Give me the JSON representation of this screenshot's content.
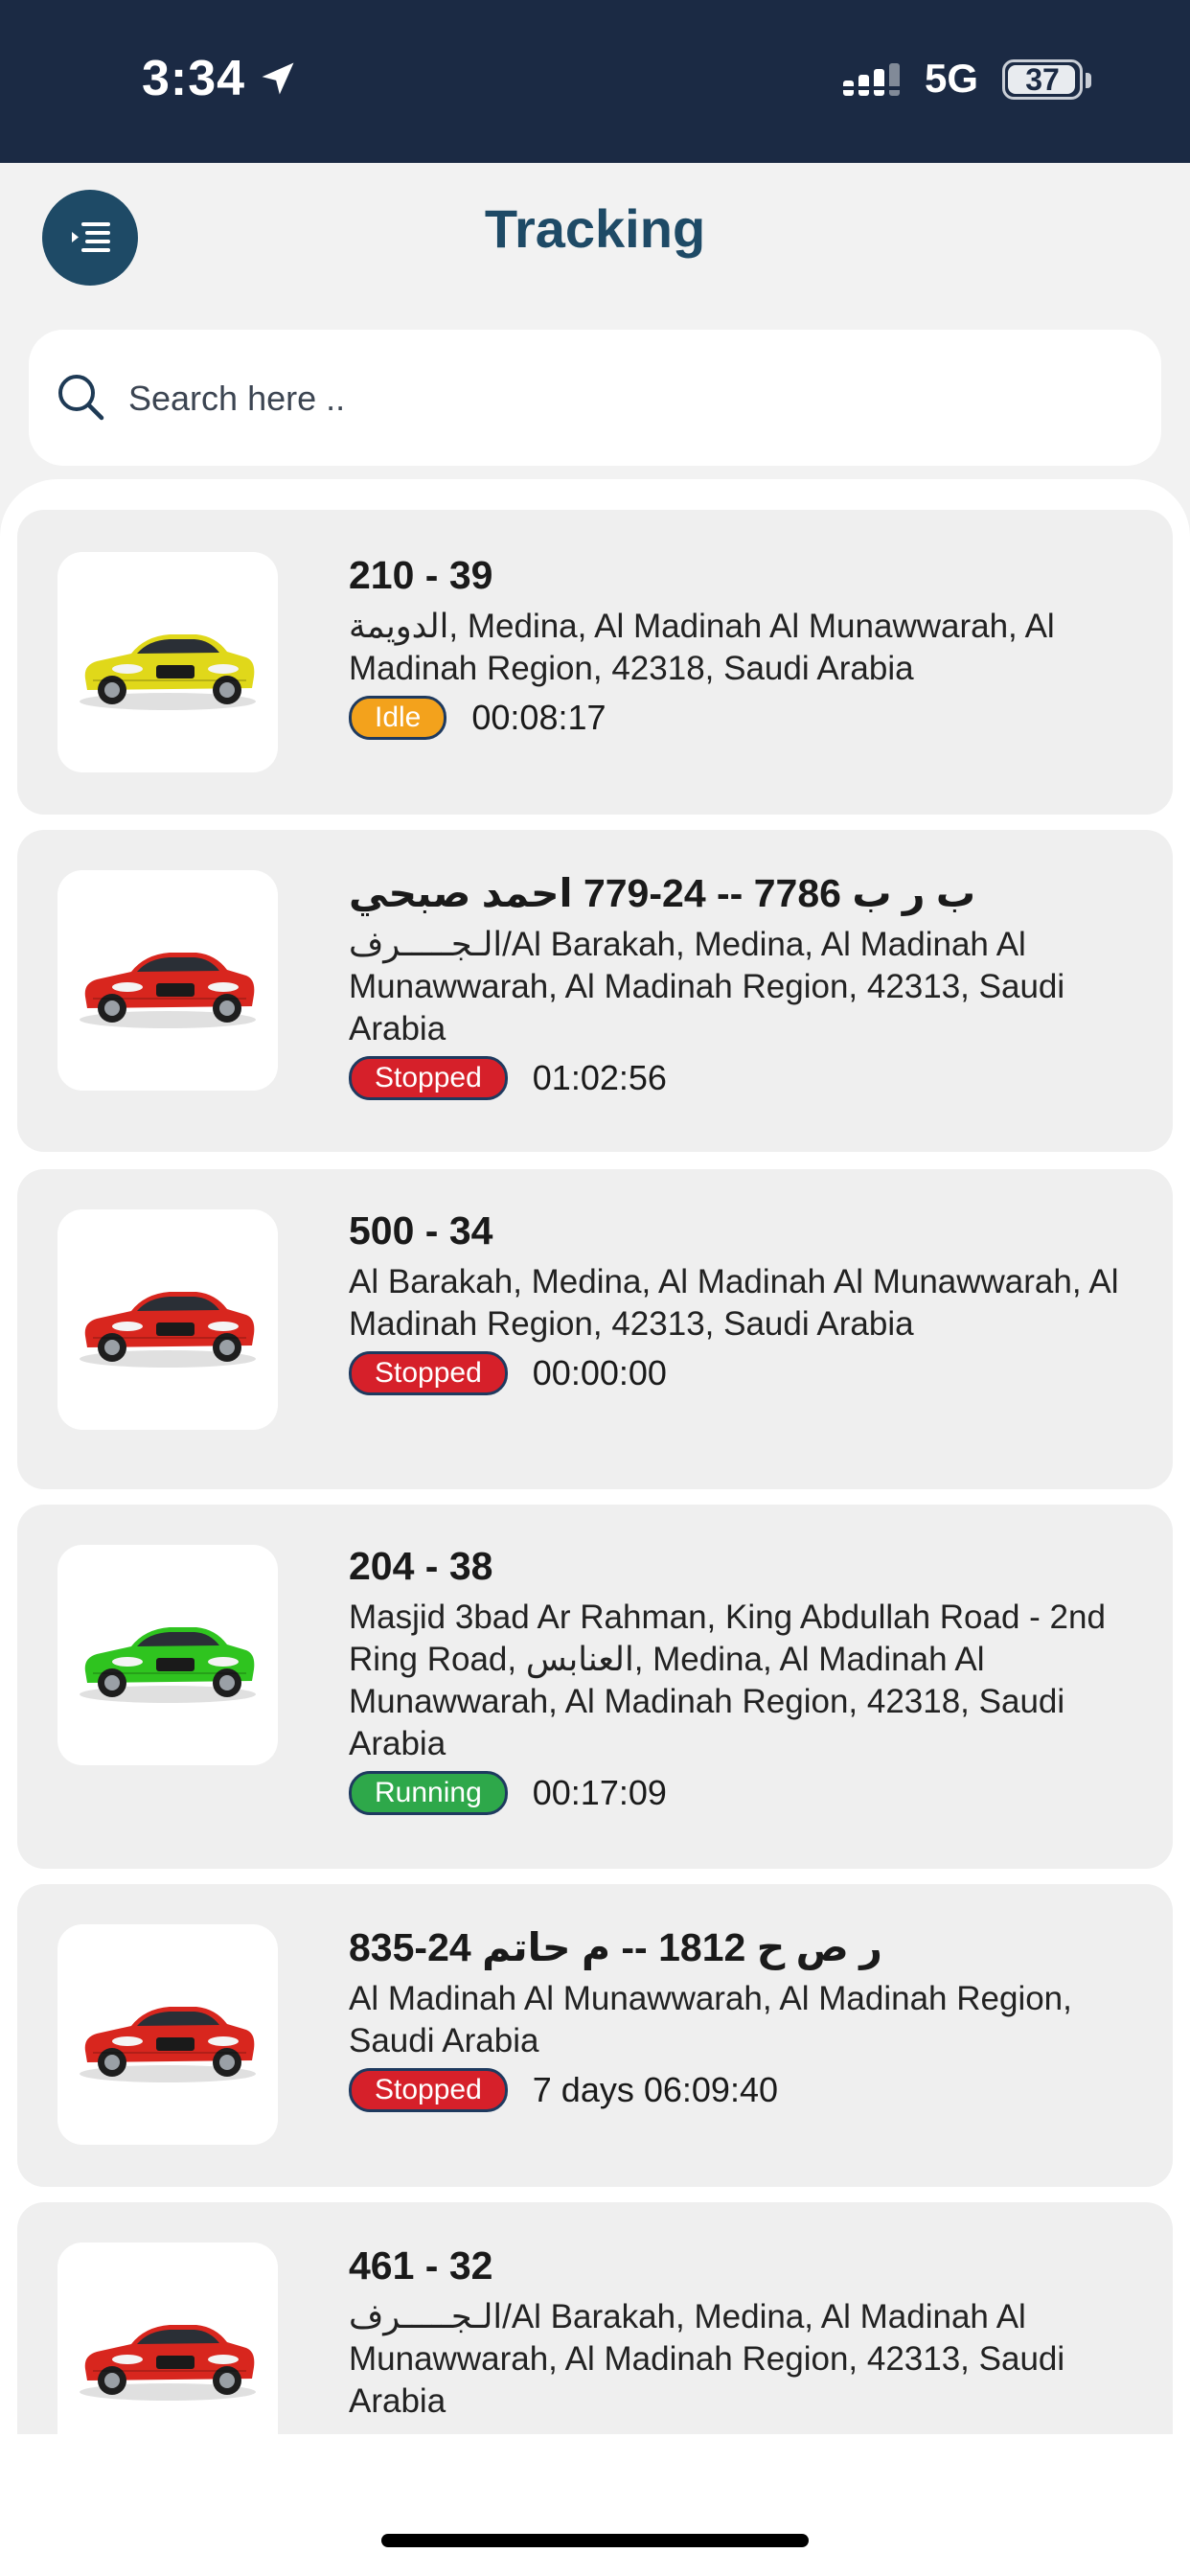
{
  "status_bar": {
    "time": "3:34",
    "network": "5G",
    "battery": "37"
  },
  "header": {
    "title": "Tracking"
  },
  "search": {
    "placeholder": "Search here .."
  },
  "colors": {
    "header_bg": "#1b2a44",
    "accent": "#1e4a66",
    "idle": "#f3a21c",
    "stopped": "#d6202a",
    "running": "#2ea84a"
  },
  "vehicles": [
    {
      "name": "210 - 39",
      "address": "الدويمة, Medina, Al Madinah Al Munawwarah, Al Madinah Region, 42318, Saudi Arabia",
      "status": "Idle",
      "duration": "00:08:17",
      "car_color": "#e0d81a"
    },
    {
      "name": "ب ر ب 7786 -- 24-779 احمد صبحي",
      "address": "الـجـــــرف/Al Barakah, Medina, Al Madinah Al Munawwarah, Al Madinah Region, 42313, Saudi Arabia",
      "status": "Stopped",
      "duration": "01:02:56",
      "car_color": "#d8261e"
    },
    {
      "name": "500 - 34",
      "address": "Al Barakah, Medina, Al Madinah Al Munawwarah, Al Madinah Region, 42313, Saudi Arabia",
      "status": "Stopped",
      "duration": "00:00:00",
      "car_color": "#d8261e"
    },
    {
      "name": "204 - 38",
      "address": "Masjid 3bad Ar Rahman, King Abdullah Road - 2nd Ring Road, العنابس, Medina, Al Madinah Al Munawwarah, Al Madinah Region, 42318, Saudi Arabia",
      "status": "Running",
      "duration": "00:17:09",
      "car_color": "#2fc41f"
    },
    {
      "name": "ر ص ح 1812 -- م حاتم 24-835",
      "address": "Al Madinah Al Munawwarah, Al Madinah Region, Saudi Arabia",
      "status": "Stopped",
      "duration": "7 days 06:09:40",
      "car_color": "#d8261e"
    },
    {
      "name": "461 - 32",
      "address": "الـجـــــرف/Al Barakah, Medina, Al Madinah Al Munawwarah, Al Madinah Region, 42313, Saudi Arabia",
      "status": "",
      "duration": "",
      "car_color": "#d8261e"
    }
  ]
}
